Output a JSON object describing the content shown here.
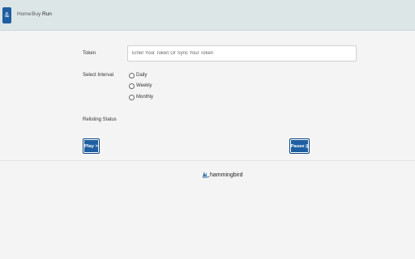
{
  "nav": {
    "brand_glyph": "&",
    "links": [
      {
        "label": "Home"
      },
      {
        "label": "Buy"
      },
      {
        "label": "Run"
      }
    ]
  },
  "form": {
    "token_label": "Token",
    "token_placeholder": "Enter Your Token Or Sync Your Token",
    "token_value": "",
    "interval_label": "Select Interval",
    "interval_options": [
      {
        "label": "Daily",
        "selected": false
      },
      {
        "label": "Weekly",
        "selected": false
      },
      {
        "label": "Monthly",
        "selected": false
      }
    ],
    "relisting_status_label": "Relisting Status",
    "play_label": "Play >",
    "pause_label": "Pause ||"
  },
  "footer": {
    "logo_text": "hammingbird",
    "logo_icon": "bird-icon"
  },
  "colors": {
    "navbar_bg": "#dde6e6",
    "accent": "#1f5fa1",
    "page_bg": "#f4f4f4"
  }
}
